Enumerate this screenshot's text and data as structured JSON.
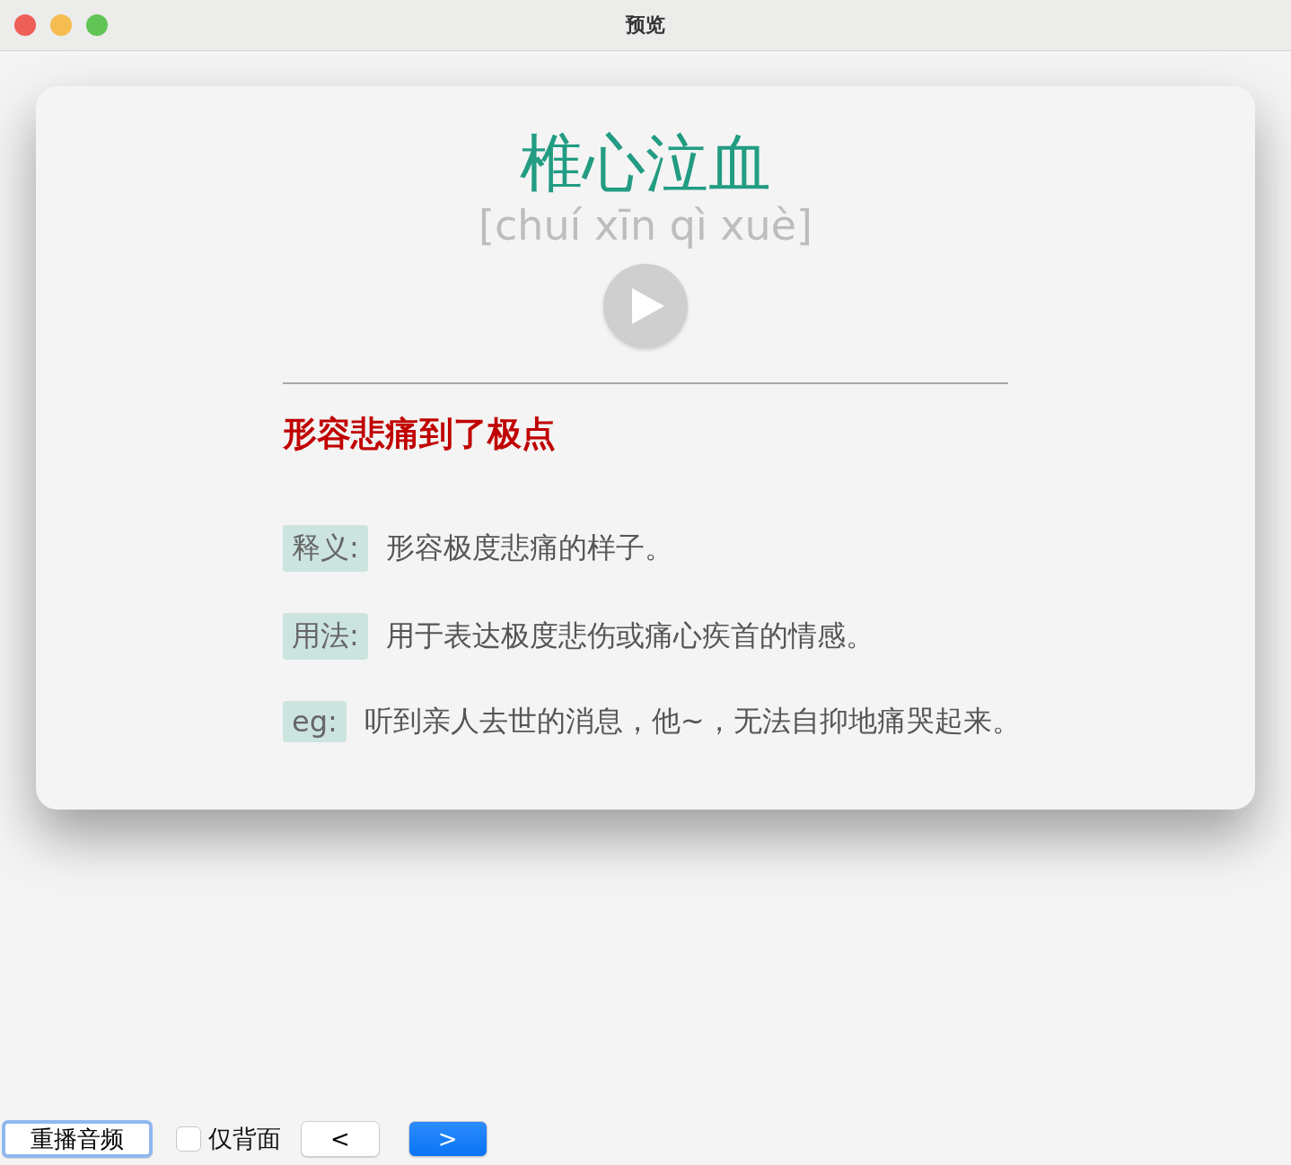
{
  "window": {
    "title": "预览"
  },
  "card": {
    "idiom": "椎心泣血",
    "pinyin": "[chuí xīn qì xuè]",
    "summary": "形容悲痛到了极点",
    "entries": [
      {
        "label": "释义:",
        "text": "形容极度悲痛的样子。"
      },
      {
        "label": "用法:",
        "text": "用于表达极度悲伤或痛心疾首的情感。"
      },
      {
        "label": "eg:",
        "text": "听到亲人去世的消息，他~，无法自抑地痛哭起来。"
      }
    ]
  },
  "toolbar": {
    "replay": {
      "label": "重播音频",
      "kind": "focused"
    },
    "back_only": {
      "label": "仅背面",
      "checked": false
    },
    "nav": [
      {
        "label": "<",
        "kind": "plain"
      },
      {
        "label": ">",
        "kind": "primary"
      }
    ]
  }
}
